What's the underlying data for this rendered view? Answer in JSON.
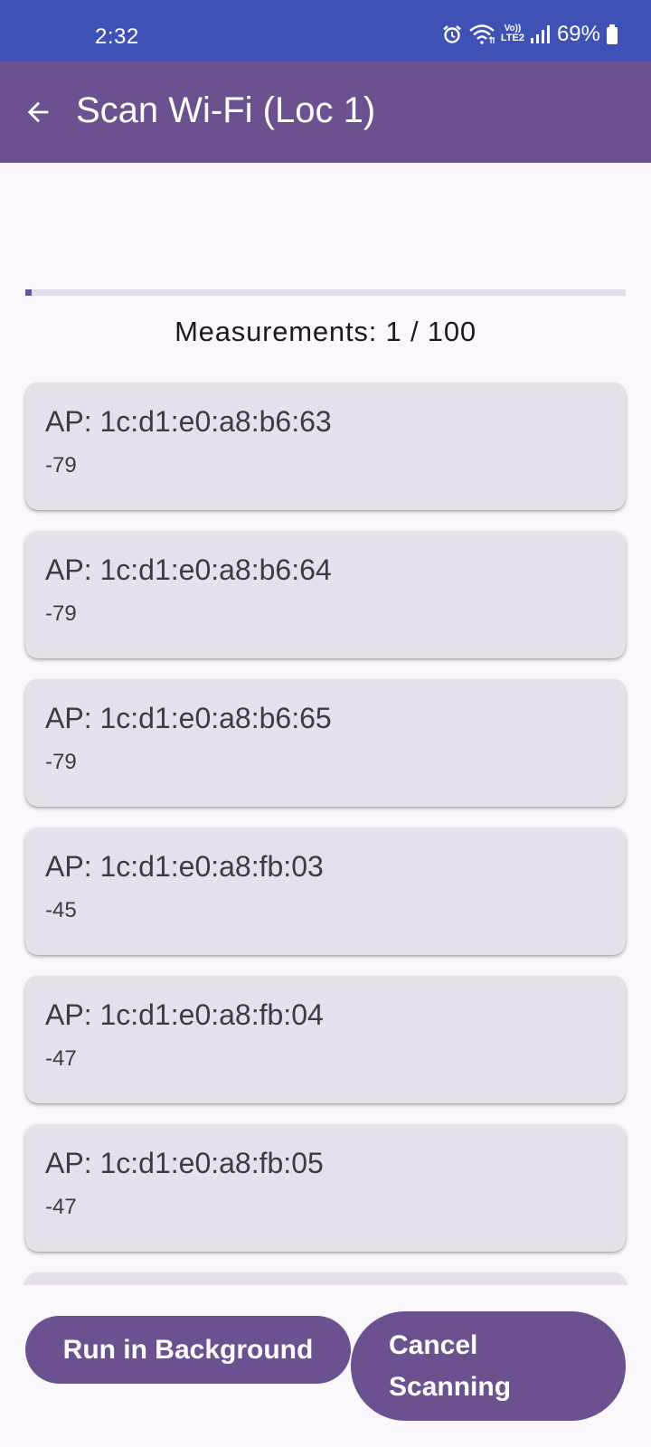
{
  "status_bar": {
    "time": "2:32",
    "network_label": "LTE2",
    "volte_label": "Vo))",
    "battery": "69%"
  },
  "app_bar": {
    "title": "Scan Wi-Fi (Loc 1)",
    "back_icon": "arrow-back-icon"
  },
  "progress": {
    "current": 1,
    "total": 100,
    "fraction": 0.01
  },
  "measurements_text": "Measurements: 1 / 100",
  "access_points": [
    {
      "name": "AP: 1c:d1:e0:a8:b6:63",
      "rssi": "-79"
    },
    {
      "name": "AP: 1c:d1:e0:a8:b6:64",
      "rssi": "-79"
    },
    {
      "name": "AP: 1c:d1:e0:a8:b6:65",
      "rssi": "-79"
    },
    {
      "name": "AP: 1c:d1:e0:a8:fb:03",
      "rssi": "-45"
    },
    {
      "name": "AP: 1c:d1:e0:a8:fb:04",
      "rssi": "-47"
    },
    {
      "name": "AP: 1c:d1:e0:a8:fb:05",
      "rssi": "-47"
    }
  ],
  "buttons": {
    "run_background": "Run in Background",
    "cancel": "Cancel\nScanning"
  },
  "colors": {
    "status_bar": "#3f51b5",
    "app_bar": "#6b5190",
    "card": "#e7e0ea",
    "background": "#fcf7fd"
  }
}
